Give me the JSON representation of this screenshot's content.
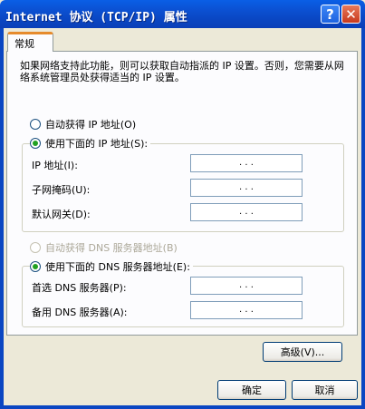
{
  "window": {
    "title": "Internet 协议 (TCP/IP) 属性",
    "help_symbol": "?",
    "close_symbol": "✕"
  },
  "tabs": [
    {
      "label": "常规"
    }
  ],
  "description": "如果网络支持此功能，则可以获取自动指派的 IP 设置。否则，您需要从网络系统管理员处获得适当的 IP 设置。",
  "ip": {
    "auto_label": "自动获得 IP 地址(O)",
    "auto_selected": false,
    "manual_label": "使用下面的 IP 地址(S):",
    "manual_selected": true,
    "fields": [
      {
        "label": "IP 地址(I):",
        "value": " .  .  . "
      },
      {
        "label": "子网掩码(U):",
        "value": " .  .  . "
      },
      {
        "label": "默认网关(D):",
        "value": " .  .  . "
      }
    ]
  },
  "dns": {
    "auto_label": "自动获得 DNS 服务器地址(B)",
    "auto_selected": false,
    "auto_disabled": true,
    "manual_label": "使用下面的 DNS 服务器地址(E):",
    "manual_selected": true,
    "fields": [
      {
        "label": "首选 DNS 服务器(P):",
        "value": " .  .  . "
      },
      {
        "label": "备用 DNS 服务器(A):",
        "value": " .  .  . "
      }
    ]
  },
  "buttons": {
    "advanced": "高级(V)...",
    "ok": "确定",
    "cancel": "取消"
  },
  "colors": {
    "titlebar": "#0A46C2",
    "tab_highlight": "#E68B2C",
    "radio_dot": "#21A121",
    "face": "#ECE9D8"
  }
}
